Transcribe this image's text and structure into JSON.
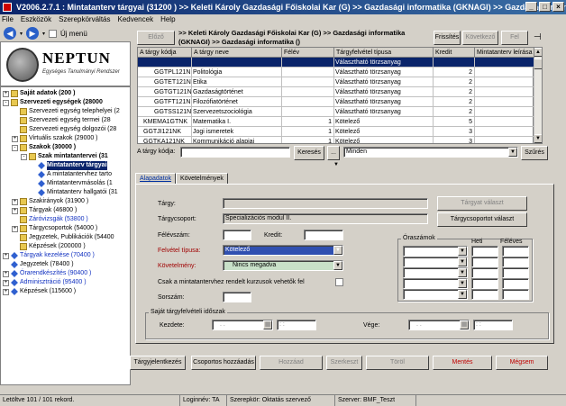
{
  "window": {
    "title": "V2006.2.7.1 : Mintatanterv tárgyai (31200 )  >> Keleti Károly Gazdasági Főiskolai Kar (G) >> Gazdasági informatika (GKNAGI) >> Gazdasági informá..."
  },
  "menu": [
    "File",
    "Eszközök",
    "Szerepkörváltás",
    "Kedvencek",
    "Help"
  ],
  "toolbar": {
    "new_menu_label": "Új menü"
  },
  "logo": {
    "name": "NEPTUN",
    "subtitle": "Egységes Tanulmányi Rendszer"
  },
  "tree": [
    {
      "label": "Saját adatok  (200 )",
      "depth": 0,
      "bold": true,
      "icon": "folder",
      "exp": "+"
    },
    {
      "label": "Szervezeti egységek  (28000",
      "depth": 0,
      "bold": true,
      "icon": "folder",
      "exp": "-"
    },
    {
      "label": "Szervezeti egység telephelyei (2",
      "depth": 1,
      "icon": "folder",
      "exp": ""
    },
    {
      "label": "Szervezeti egység termei (28",
      "depth": 1,
      "icon": "folder",
      "exp": ""
    },
    {
      "label": "Szervezeti egység dolgozói (28",
      "depth": 1,
      "icon": "folder",
      "exp": ""
    },
    {
      "label": "Virtuális szakok  (29000 )",
      "depth": 1,
      "icon": "folder",
      "exp": "+"
    },
    {
      "label": "Szakok  (30000 )",
      "depth": 1,
      "bold": true,
      "icon": "folder",
      "exp": "-"
    },
    {
      "label": "Szak mintatantervei (31",
      "depth": 2,
      "bold": true,
      "icon": "folder",
      "exp": "-"
    },
    {
      "label": "Mintatanterv tárgyai",
      "depth": 3,
      "bold": true,
      "icon": "diamond",
      "exp": "",
      "selected": true
    },
    {
      "label": "A mintatantervhez tarto",
      "depth": 3,
      "icon": "diamond",
      "exp": ""
    },
    {
      "label": "Mintatantervmásolás (1",
      "depth": 3,
      "icon": "diamond",
      "exp": ""
    },
    {
      "label": "Mintatanterv hallgatói (31",
      "depth": 3,
      "icon": "diamond",
      "exp": ""
    },
    {
      "label": "Szakirányok  (31900 )",
      "depth": 1,
      "icon": "folder",
      "exp": "+"
    },
    {
      "label": "Tárgyak  (46800 )",
      "depth": 1,
      "icon": "folder",
      "exp": "+"
    },
    {
      "label": "Záróvizsgák  (53800 )",
      "depth": 1,
      "icon": "folder",
      "exp": "",
      "blue": true
    },
    {
      "label": "Tárgycsoportok  (54000 )",
      "depth": 1,
      "icon": "folder",
      "exp": "+"
    },
    {
      "label": "Jegyzetek, Publikációk  (54400",
      "depth": 1,
      "icon": "folder",
      "exp": ""
    },
    {
      "label": "Képzések  (200000 )",
      "depth": 1,
      "icon": "folder",
      "exp": ""
    },
    {
      "label": "Tárgyak kezelése  (70400 )",
      "depth": 0,
      "icon": "diamond",
      "exp": "+",
      "blue": true
    },
    {
      "label": "Jegyzetek  (78400 )",
      "depth": 0,
      "icon": "diamond",
      "exp": ""
    },
    {
      "label": "Órarendkészítés  (90400 )",
      "depth": 0,
      "icon": "diamond",
      "exp": "+",
      "blue": true
    },
    {
      "label": "Adminisztráció  (95400 )",
      "depth": 0,
      "icon": "diamond",
      "exp": "+",
      "blue": true
    },
    {
      "label": "Képzések  (115600 )",
      "depth": 0,
      "icon": "diamond",
      "exp": "+"
    }
  ],
  "breadcrumb": ">> Keleti Károly Gazdasági Főiskolai Kar (G) >> Gazdasági informatika (GKNAGI) >> Gazdasági informatika ()",
  "top_buttons": {
    "prev": "Előző",
    "refresh": "Frissítés",
    "next": "Következő",
    "up": "Fel"
  },
  "grid": {
    "columns": [
      "A tárgy kódja",
      "A tárgy neve",
      "Félév",
      "Tárgyfelvétel típusa",
      "Kredit",
      "Mintatanterv leírása"
    ],
    "rows": [
      [
        "",
        "",
        "",
        "Választható törzsanyag",
        "",
        ""
      ],
      [
        "GGTPL121NK",
        "Politológia",
        "",
        "Választható törzsanyag",
        "2",
        ""
      ],
      [
        "GGTET121NK",
        "Etika",
        "",
        "Választható törzsanyag",
        "2",
        ""
      ],
      [
        "GGTGT121NK",
        "Gazdaságtörténet",
        "",
        "Választható törzsanyag",
        "2",
        ""
      ],
      [
        "GGTFT121NK",
        "Filozófiatörténet",
        "",
        "Választható törzsanyag",
        "2",
        ""
      ],
      [
        "GGTSS121NK",
        "Szervezetszociológia",
        "",
        "Választható törzsanyag",
        "2",
        ""
      ],
      [
        "KMEMA1GTNK",
        "Matematika I.",
        "1",
        "Kötelező",
        "5",
        ""
      ],
      [
        "GGTJI121NK",
        "Jogi ismeretek",
        "1",
        "Kötelező",
        "3",
        ""
      ],
      [
        "GGTKA121NK",
        "Kommunikáció alapjai",
        "1",
        "Kötelező",
        "3",
        ""
      ]
    ]
  },
  "search": {
    "label": "A tárgy kódja:",
    "button": "Keresés",
    "more": "...",
    "filter_value": "Minden",
    "filter_button": "Szűrés"
  },
  "tabs": [
    "Alapadatok",
    "Követelmények"
  ],
  "form": {
    "targy_label": "Tárgy:",
    "targy_value": "",
    "targy_button": "Tárgyat választ",
    "targycsoport_label": "Tárgycsoport:",
    "targycsoport_value": "Specializációs modul II.",
    "targycsoport_button": "Tárgycsoportot választ",
    "felevszam_label": "Félévszám:",
    "felevszam_value": "",
    "kredit_label": "Kredit:",
    "kredit_value": "",
    "felvetel_label": "Felvétel típusa:",
    "felvetel_value": "Kötelező",
    "kovetelmeny_label": "Követelmény:",
    "kovetelmeny_value": "Nincs megadva",
    "csak_label": "Csak a mintatantervhez rendelt kurzusok vehetők fel",
    "sorszam_label": "Sorszám:",
    "sorszam_value": "",
    "oraszamok_label": "Óraszámok",
    "heti_label": "Heti",
    "feleves_label": "Féléves",
    "period_title": "Saját tárgyfelvételi időszak",
    "kezdete_label": "Kezdete:",
    "kezdete_date": ". .",
    "kezdete_time": ": :",
    "vege_label": "Vége:",
    "vege_date": ". .",
    "vege_time": ": :"
  },
  "bottom_buttons": {
    "targyjelentkezes": "Tárgyjelentkezés",
    "csoportos": "Csoportos hozzáadás",
    "hozzaad": "Hozzáad",
    "szerkeszt": "Szerkeszt",
    "torol": "Töröl",
    "mentes": "Mentés",
    "megsem": "Mégsem"
  },
  "status": {
    "records": "Letöltve 101 / 101 rekord.",
    "login": "Loginnév: TA",
    "role": "Szerepkör: Oktatás szervező",
    "server": "Szerver: BMF_Teszt"
  },
  "colors": {
    "title_start": "#0a246a",
    "title_end": "#3a6ea5",
    "selected_row": "#0a246a",
    "required_field": "#c8e0c8",
    "danger": "#c00000"
  }
}
